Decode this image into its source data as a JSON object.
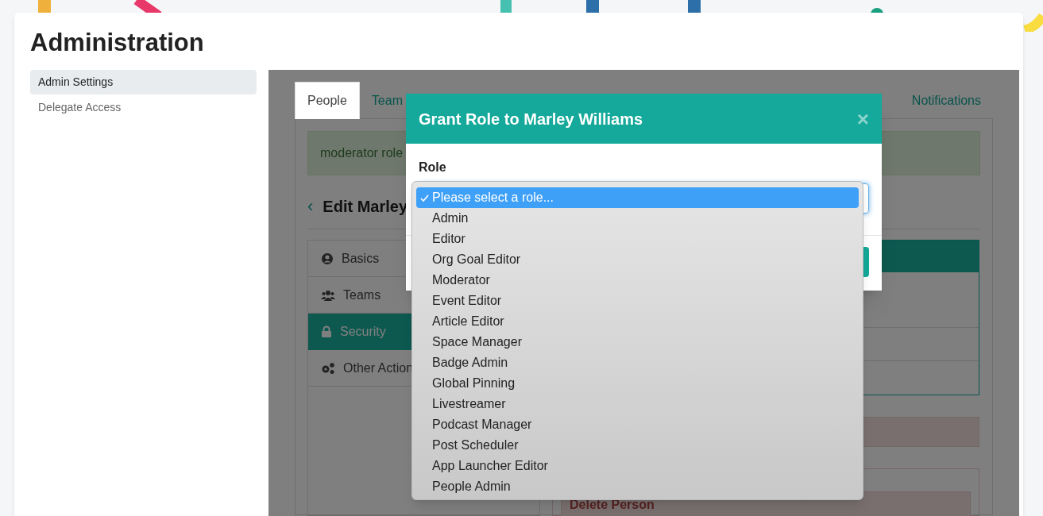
{
  "page": {
    "title": "Administration"
  },
  "sidebar": {
    "items": [
      {
        "label": "Admin Settings",
        "selected": true
      },
      {
        "label": "Delegate Access",
        "selected": false
      }
    ]
  },
  "tabs": [
    {
      "label": "People",
      "selected": true
    },
    {
      "label": "Team",
      "selected": false
    },
    {
      "label": "Notifications",
      "selected": false
    }
  ],
  "alert": {
    "text": "moderator role"
  },
  "editor": {
    "back": "‹",
    "title": "Edit Marley",
    "sections": [
      {
        "label": "Basics",
        "selected": false
      },
      {
        "label": "Teams",
        "selected": false
      },
      {
        "label": "Security",
        "selected": true
      },
      {
        "label": "Other Action",
        "selected": false
      }
    ]
  },
  "danger": {
    "button": "Delete Person"
  },
  "modal": {
    "title": "Grant Role to Marley Williams",
    "close": "×",
    "field_label": "Role",
    "options": [
      {
        "label": "Please select a role...",
        "selected": true
      },
      {
        "label": "Admin",
        "selected": false
      },
      {
        "label": "Editor",
        "selected": false
      },
      {
        "label": "Org Goal Editor",
        "selected": false
      },
      {
        "label": "Moderator",
        "selected": false
      },
      {
        "label": "Event Editor",
        "selected": false
      },
      {
        "label": "Article Editor",
        "selected": false
      },
      {
        "label": "Space Manager",
        "selected": false
      },
      {
        "label": "Badge Admin",
        "selected": false
      },
      {
        "label": "Global Pinning",
        "selected": false
      },
      {
        "label": "Livestreamer",
        "selected": false
      },
      {
        "label": "Podcast Manager",
        "selected": false
      },
      {
        "label": "Post Scheduler",
        "selected": false
      },
      {
        "label": "App Launcher Editor",
        "selected": false
      },
      {
        "label": "People Admin",
        "selected": false
      }
    ]
  }
}
